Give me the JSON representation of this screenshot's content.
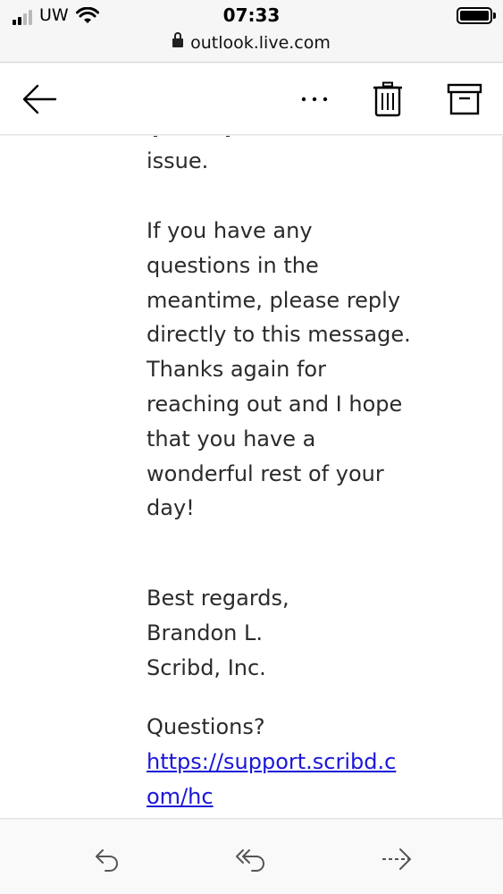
{
  "status_bar": {
    "carrier": "UW",
    "time": "07:33",
    "url": "outlook.live.com",
    "icons": [
      "signal-icon",
      "wifi-icon",
      "battery-icon",
      "lock-icon"
    ]
  },
  "toolbar": {
    "icons": [
      "back-arrow-icon",
      "more-icon",
      "trash-icon",
      "archive-icon"
    ]
  },
  "email": {
    "body_lines": [
      "issue.",
      "",
      "If you have any\nquestions in the\nmeantime, please reply\ndirectly to this message.\nThanks again for\nreaching out and I hope\nthat you have a\nwonderful rest of your\nday!"
    ],
    "signoff": "Best regards,\nBrandon L.\nScribd, Inc.",
    "questions_label": "Questions?",
    "support_link": "https://support.scribd.c\nom/hc"
  },
  "bottom_bar": {
    "icons": [
      "reply-icon",
      "reply-all-icon",
      "forward-icon"
    ]
  },
  "colors": {
    "link": "#1a16d8",
    "text": "#2b2b2b",
    "chrome": "#f6f6f6"
  }
}
